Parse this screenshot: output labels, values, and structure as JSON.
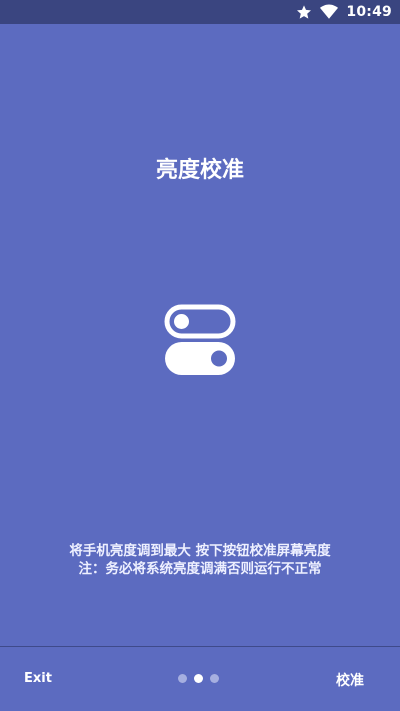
{
  "status_bar": {
    "time": "10:49",
    "icons": [
      "star-icon",
      "wifi-icon"
    ]
  },
  "main": {
    "title": "亮度校准",
    "instruction_line1": "将手机亮度调到最大 按下按钮校准屏幕亮度",
    "instruction_line2": "注：务必将系统亮度调满否则运行不正常",
    "graphic_icon": "toggle-switches-icon"
  },
  "bottom_bar": {
    "exit_label": "Exit",
    "calibrate_label": "校准",
    "page_count": 3,
    "current_page": 2
  },
  "colors": {
    "background": "#5c6bc0",
    "status_bar": "#3a4580",
    "text": "#ffffff"
  }
}
